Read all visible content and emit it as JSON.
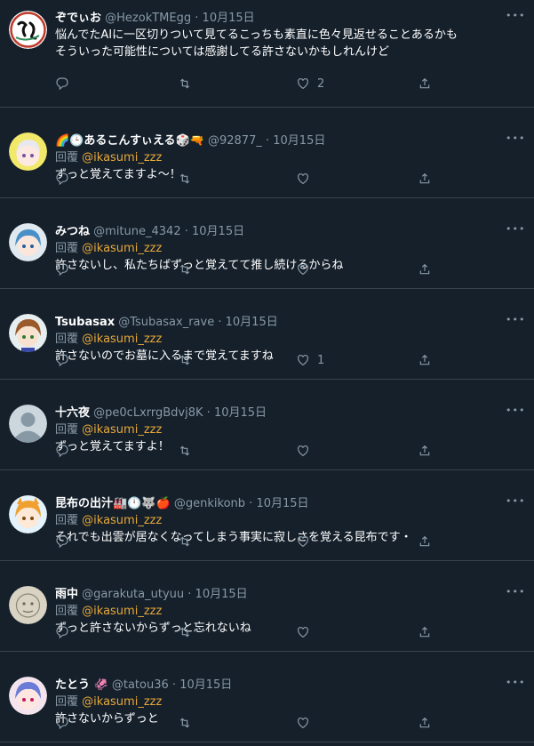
{
  "reply_prefix": "回覆",
  "tweets": [
    {
      "name": "ぞでぃお",
      "handle": "@HezokTMEgg",
      "date": "10月15日",
      "lines": [
        "悩んでたAIに一区切りついて見てるこっちも素直に色々見返せることあるかも",
        "そういった可能性については感謝してる許さないかもしれんけど"
      ],
      "likes": "2",
      "avatar": "logo"
    },
    {
      "name": "🌈🕒あるこんすぃえる🎲🔫",
      "handle": "@92877_",
      "date": "10月15日",
      "reply_to": "@ikasumi_zzz",
      "lines": [
        "ずっと覚えてますよ～！"
      ],
      "likes": "",
      "avatar": "anime-white"
    },
    {
      "name": "みつね",
      "handle": "@mitune_4342",
      "date": "10月15日",
      "reply_to": "@ikasumi_zzz",
      "lines": [
        "許さないし、私たちばずっと覚えてて推し続けるからね"
      ],
      "likes": "",
      "avatar": "anime-blue"
    },
    {
      "name": "Tsubasax",
      "handle": "@Tsubasax_rave",
      "date": "10月15日",
      "reply_to": "@ikasumi_zzz",
      "lines": [
        "許さないのでお墓に入るまで覚えてますね"
      ],
      "likes": "1",
      "avatar": "anime-brown"
    },
    {
      "name": "十六夜",
      "handle": "@pe0cLxrrgBdvj8K",
      "date": "10月15日",
      "reply_to": "@ikasumi_zzz",
      "lines": [
        "ずっと覚えてますよ！"
      ],
      "likes": "",
      "avatar": "default"
    },
    {
      "name": "昆布の出汁🏭🕛🐺🍎",
      "handle": "@genkikonb",
      "date": "10月15日",
      "reply_to": "@ikasumi_zzz",
      "lines": [
        "それでも出雲が居なくなってしまう事実に寂しさを覚える昆布です・"
      ],
      "likes": "",
      "avatar": "anime-orange"
    },
    {
      "name": "雨中",
      "handle": "@garakuta_utyuu",
      "date": "10月15日",
      "reply_to": "@ikasumi_zzz",
      "lines": [
        "ずっと許さないからずっと忘れないね"
      ],
      "likes": "",
      "avatar": "sketch"
    },
    {
      "name": "たとう 🦑",
      "handle": "@tatou36",
      "date": "10月15日",
      "reply_to": "@ikasumi_zzz",
      "lines": [
        "許さないからずっと"
      ],
      "likes": "",
      "avatar": "anime-pink"
    }
  ]
}
